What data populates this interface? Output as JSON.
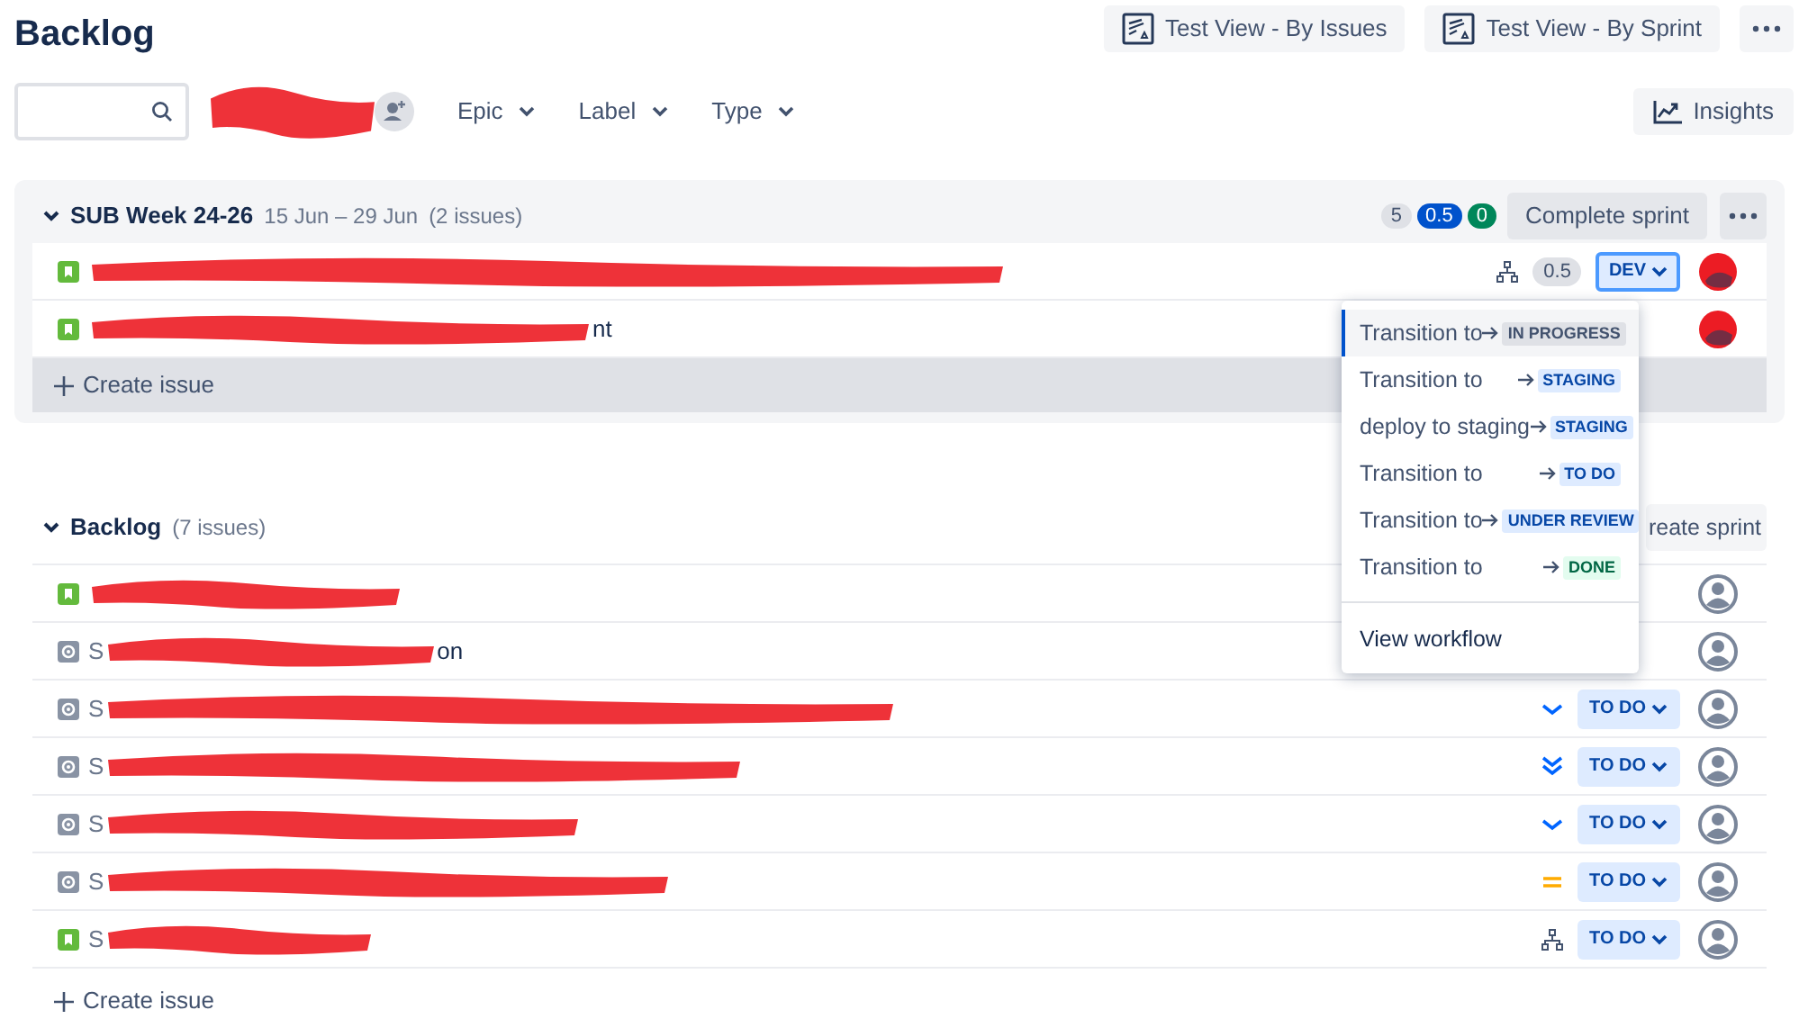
{
  "page_title": "Backlog",
  "view_buttons": [
    {
      "label": "Test View - By Issues"
    },
    {
      "label": "Test View - By Sprint"
    }
  ],
  "filters": [
    {
      "label": "Epic"
    },
    {
      "label": "Label"
    },
    {
      "label": "Type"
    }
  ],
  "insights_button": "Insights",
  "sprint": {
    "name": "SUB Week 24-26",
    "dates": "15 Jun – 29 Jun",
    "count": "(2 issues)",
    "badges": [
      {
        "value": "5",
        "color": "#dfe1e6"
      },
      {
        "value": "0.5",
        "color": "#0052cc"
      },
      {
        "value": "0",
        "color": "#00875a"
      }
    ],
    "complete_button": "Complete sprint",
    "issues": [
      {
        "type_icon": {
          "kind": "story"
        },
        "indicator": {
          "kind": "hierarchy"
        },
        "story_points": "0.5",
        "status": "DEV",
        "status_focused": true,
        "avatar": {
          "kind": "redacted"
        }
      },
      {
        "type_icon": {
          "kind": "story"
        },
        "suffix": "nt",
        "avatar": {
          "kind": "redacted"
        }
      }
    ],
    "create_issue": "Create issue"
  },
  "backlog": {
    "name": "Backlog",
    "count": "(7 issues)",
    "create_sprint_button": "reate sprint",
    "issues": [
      {
        "type_icon": {
          "kind": "story"
        },
        "avatar": {
          "kind": "unassigned"
        }
      },
      {
        "type_icon": {
          "kind": "task"
        },
        "prefix": "S",
        "suffix": "on",
        "avatar": {
          "kind": "unassigned"
        }
      },
      {
        "type_icon": {
          "kind": "task"
        },
        "prefix": "S",
        "indicator": {
          "kind": "low"
        },
        "status": "TO DO",
        "status_focused": false,
        "avatar": {
          "kind": "unassigned"
        }
      },
      {
        "type_icon": {
          "kind": "task"
        },
        "prefix": "S",
        "indicator": {
          "kind": "lowest"
        },
        "status": "TO DO",
        "status_focused": false,
        "avatar": {
          "kind": "unassigned"
        }
      },
      {
        "type_icon": {
          "kind": "task"
        },
        "prefix": "S",
        "indicator": {
          "kind": "low"
        },
        "status": "TO DO",
        "status_focused": false,
        "avatar": {
          "kind": "unassigned"
        }
      },
      {
        "type_icon": {
          "kind": "task"
        },
        "prefix": "S",
        "indicator": {
          "kind": "medium"
        },
        "status": "TO DO",
        "status_focused": false,
        "avatar": {
          "kind": "unassigned"
        }
      },
      {
        "type_icon": {
          "kind": "story"
        },
        "prefix": "S",
        "indicator": {
          "kind": "hierarchy"
        },
        "status": "TO DO",
        "status_focused": false,
        "avatar": {
          "kind": "unassigned"
        }
      }
    ],
    "create_issue": "Create issue"
  },
  "transition_menu": {
    "items": [
      {
        "label": "Transition to",
        "target": {
          "label": "IN PROGRESS",
          "kind": "neutral"
        },
        "selected": true
      },
      {
        "label": "Transition to",
        "target": {
          "label": "STAGING",
          "kind": "active"
        },
        "selected": false
      },
      {
        "label": "deploy to staging",
        "target": {
          "label": "STAGING",
          "kind": "active"
        },
        "selected": false
      },
      {
        "label": "Transition to",
        "target": {
          "label": "TO DO",
          "kind": "active"
        },
        "selected": false
      },
      {
        "label": "Transition to",
        "target": {
          "label": "UNDER REVIEW",
          "kind": "active"
        },
        "selected": false
      },
      {
        "label": "Transition to",
        "target": {
          "label": "DONE",
          "kind": "success"
        },
        "selected": false
      }
    ],
    "footer": "View workflow"
  }
}
